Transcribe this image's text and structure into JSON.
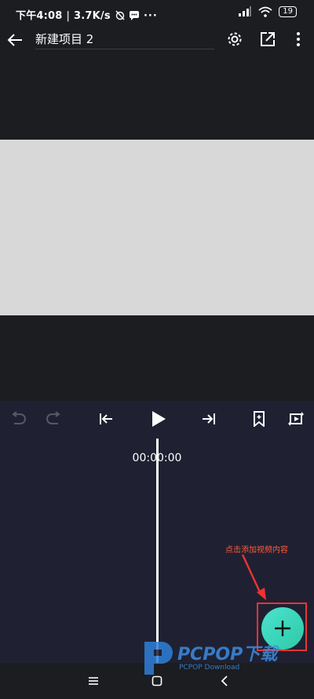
{
  "status_bar": {
    "time": "下午4:08",
    "speed": "3.7K/s",
    "battery": "19"
  },
  "app_bar": {
    "project_title": "新建项目 2"
  },
  "timeline": {
    "timecode": "00:00:00",
    "hint": "点击添加视频内容"
  },
  "watermark": {
    "brand": "PCPOP下载",
    "sub": "PCPOP Download"
  },
  "colors": {
    "accent": "#34d3b8",
    "annotation": "#e33333",
    "timeline_bg": "#1f2132"
  }
}
